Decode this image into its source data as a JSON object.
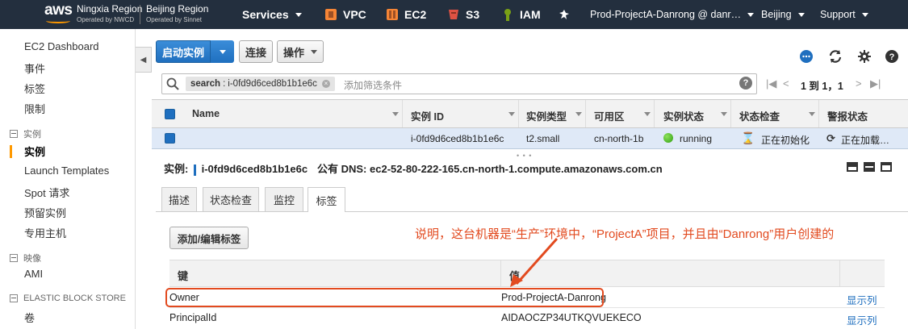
{
  "topnav": {
    "logo_text": "aws",
    "region1": {
      "name": "Ningxia Region",
      "sub": "Operated by NWCD"
    },
    "region2": {
      "name": "Beijing Region",
      "sub": "Operated by Sinnet"
    },
    "services": "Services",
    "vpc": "VPC",
    "ec2": "EC2",
    "s3": "S3",
    "iam": "IAM",
    "account": "Prod-ProjectA-Danrong @ danr…",
    "region_select": "Beijing",
    "support": "Support",
    "colors": {
      "bg": "#232f3e",
      "accent": "#ff9900"
    }
  },
  "sidebar": {
    "items": {
      "dashboard": "EC2 Dashboard",
      "events": "事件",
      "tags": "标签",
      "limits": "限制",
      "instances_group": "实例",
      "instances": "实例",
      "launch_templates": "Launch Templates",
      "spot": "Spot 请求",
      "reserved": "预留实例",
      "dedicated": "专用主机",
      "images_group": "映像",
      "ami": "AMI",
      "ebs_group": "ELASTIC BLOCK STORE",
      "volumes": "卷"
    }
  },
  "toolbar": {
    "launch": "启动实例",
    "connect": "连接",
    "actions": "操作"
  },
  "filter": {
    "token_key": "search",
    "token_value": "i-0fd9d6ced8b1b1e6c",
    "placeholder": "添加筛选条件",
    "help": "?",
    "page_info": "1 到 1，1"
  },
  "table": {
    "headers": [
      "Name",
      "实例 ID",
      "实例类型",
      "可用区",
      "实例状态",
      "状态检查",
      "警报状态"
    ],
    "row": {
      "name": "",
      "instance_id": "i-0fd9d6ced8b1b1e6c",
      "type": "t2.small",
      "az": "cn-north-1b",
      "state": "running",
      "status_check": "正在初始化",
      "alarm": "正在加载…"
    }
  },
  "detail": {
    "label": "实例:",
    "instance_id": "i-0fd9d6ced8b1b1e6c",
    "dns_label": "公有 DNS:",
    "dns": "ec2-52-80-222-165.cn-north-1.compute.amazonaws.com.cn",
    "tabs": [
      "描述",
      "状态检查",
      "监控",
      "标签"
    ],
    "active_tab": "标签",
    "edit_tags": "添加/编辑标签",
    "annotation": "说明，这台机器是“生产”环境中，“ProjectA”项目，并且由“Danrong”用户创建的",
    "tag_headers": {
      "key": "键",
      "value": "值"
    },
    "tags": [
      {
        "key": "Owner",
        "value": "Prod-ProjectA-Danrong",
        "action": "显示列"
      },
      {
        "key": "PrincipalId",
        "value": "AIDAOCZP34UTKQVUEKECO",
        "action": "显示列"
      }
    ],
    "colors": {
      "annotation": "#e24a1f",
      "link": "#1f6fbf"
    }
  }
}
